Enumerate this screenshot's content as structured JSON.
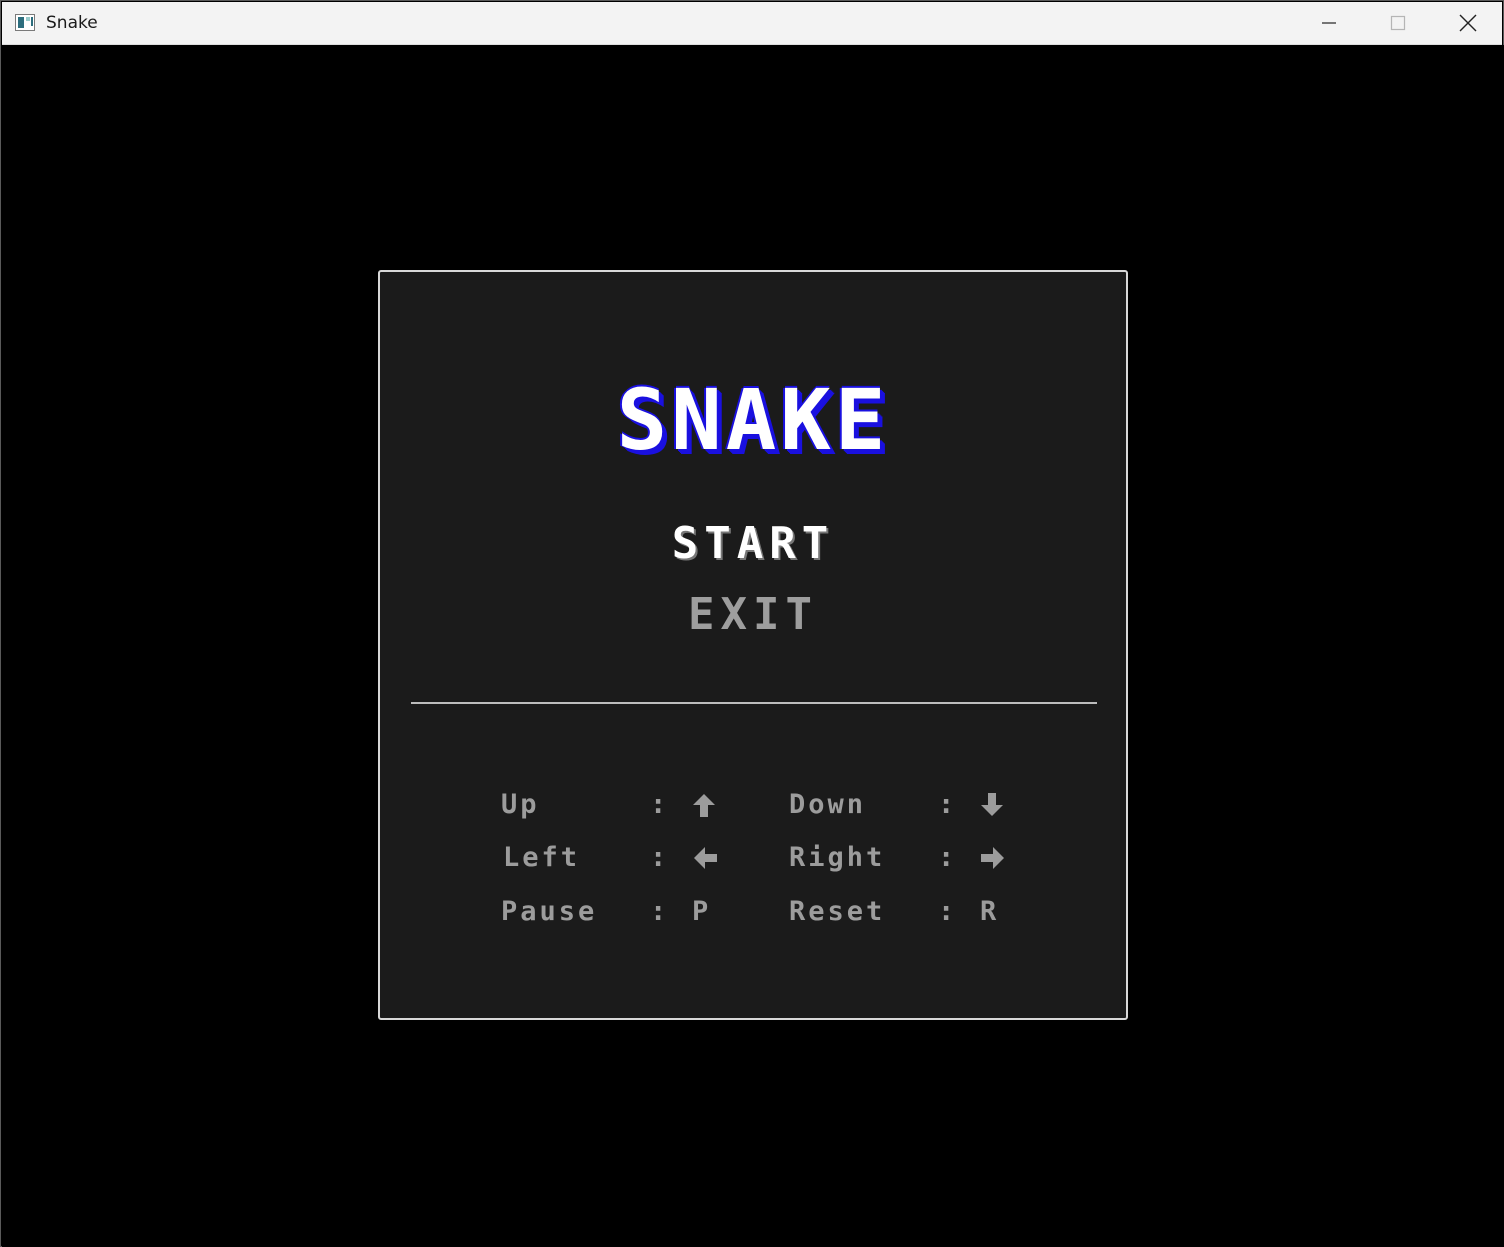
{
  "window": {
    "title": "Snake",
    "icons": {
      "app": "app-window-icon",
      "minimize": "minimize-icon",
      "maximize": "maximize-icon",
      "close": "close-icon"
    }
  },
  "menu": {
    "title": "SNAKE",
    "title_color": "#ffffff",
    "title_shadow_color": "#1a10e0",
    "items": [
      {
        "label": "START",
        "selected": true
      },
      {
        "label": "EXIT",
        "selected": false
      }
    ]
  },
  "controls": {
    "separator": ":",
    "left_column": [
      {
        "action": "Up",
        "key": "up-arrow-icon"
      },
      {
        "action": "Left",
        "key": "left-arrow-icon"
      },
      {
        "action": "Pause",
        "key": "P"
      }
    ],
    "right_column": [
      {
        "action": "Down",
        "key": "down-arrow-icon"
      },
      {
        "action": "Right",
        "key": "right-arrow-icon"
      },
      {
        "action": "Reset",
        "key": "R"
      }
    ]
  }
}
